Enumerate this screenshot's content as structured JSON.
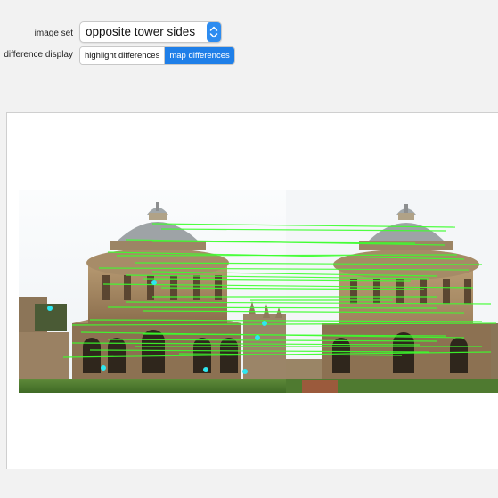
{
  "controls": {
    "image_set": {
      "label": "image set",
      "selected": "opposite tower sides"
    },
    "difference_display": {
      "label": "difference display",
      "options": [
        "highlight differences",
        "map differences"
      ],
      "selected": "map differences"
    }
  },
  "colors": {
    "match_line": "#3cff2c",
    "keypoint": "#2ee6f0",
    "active_button": "#1f7fe8"
  }
}
